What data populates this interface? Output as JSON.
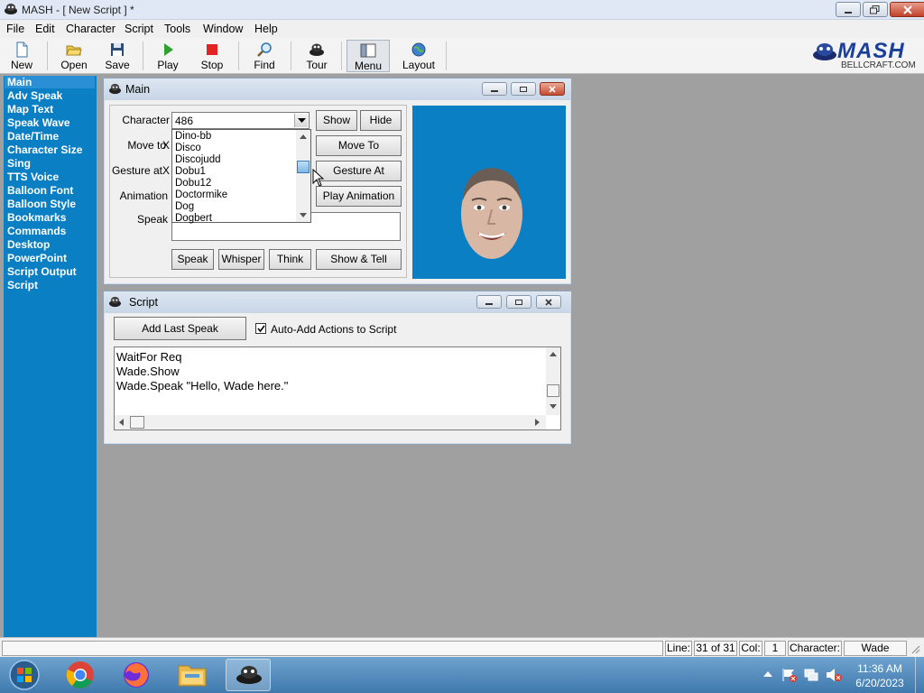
{
  "window": {
    "title": "MASH - [ New Script ] *"
  },
  "menu": [
    "File",
    "Edit",
    "Character",
    "Script",
    "Tools",
    "Window",
    "Help"
  ],
  "toolbar": {
    "new": "New",
    "open": "Open",
    "save": "Save",
    "play": "Play",
    "stop": "Stop",
    "find": "Find",
    "tour": "Tour",
    "menu": "Menu",
    "layout": "Layout"
  },
  "brand": {
    "logo": "MASH",
    "site": "BELLCRAFT.COM"
  },
  "sidebar": {
    "items": [
      "Main",
      "Adv Speak",
      "Map Text",
      "Speak Wave",
      "Date/Time",
      "Character Size",
      "Sing",
      "TTS Voice",
      "Balloon Font",
      "Balloon Style",
      "Bookmarks",
      "Commands",
      "Desktop",
      "PowerPoint",
      "Script Output",
      "Script"
    ],
    "selected": "Main"
  },
  "main_window": {
    "title": "Main",
    "labels": {
      "character": "Character",
      "move_to": "Move to",
      "gesture_at": "Gesture at",
      "animation": "Animation",
      "speak": "Speak",
      "x1": "X",
      "x2": "X"
    },
    "character_value": "486",
    "dropdown_items": [
      "Dino-bb",
      "Disco",
      "Discojudd",
      "Dobu1",
      "Dobu12",
      "Doctormike",
      "Dog",
      "Dogbert"
    ],
    "buttons": {
      "show": "Show",
      "hide": "Hide",
      "move_to": "Move To",
      "gesture_at": "Gesture At",
      "play_animation": "Play Animation",
      "speak": "Speak",
      "whisper": "Whisper",
      "think": "Think",
      "show_tell": "Show & Tell"
    },
    "preview_bg": "#0a7fc4"
  },
  "script_window": {
    "title": "Script",
    "add_last_speak": "Add Last Speak",
    "auto_add_label": "Auto-Add Actions to Script",
    "auto_add_checked": true,
    "lines": [
      "WaitFor Req",
      "Wade.Show",
      "Wade.Speak \"Hello, Wade here.\""
    ]
  },
  "status": {
    "line_label": "Line:",
    "line_value": "31 of 31",
    "col_label": "Col:",
    "col_value": "1",
    "character_label": "Character:",
    "character_value": "Wade"
  },
  "taskbar": {
    "icons": [
      "start-orb-icon",
      "chrome-icon",
      "firefox-icon",
      "file-explorer-icon",
      "mash-icon"
    ],
    "time": "11:36 AM",
    "date": "6/20/2023"
  },
  "colors": {
    "sidebar": "#0a7fc4",
    "sidebar_selected": "#2a8fd4",
    "mdi_bg": "#a0a0a0"
  }
}
